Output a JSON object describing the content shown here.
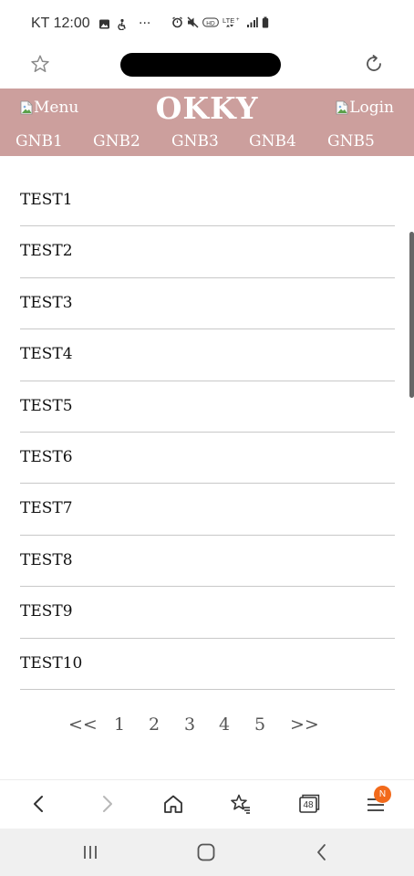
{
  "status_bar": {
    "carrier_time": "KT 12:00",
    "overflow_glyph": "···",
    "icons": [
      "gallery-icon",
      "accessibility-icon",
      "alarm-icon",
      "mute-icon",
      "hd-voice-icon",
      "lte-plus-icon",
      "signal-icon",
      "battery-icon"
    ]
  },
  "browser": {
    "url_redacted": true
  },
  "header": {
    "logo": "OKKY",
    "menu_alt": "Menu",
    "login_alt": "Login",
    "background_color": "#cc9f9d",
    "gnb": [
      "GNB1",
      "GNB2",
      "GNB3",
      "GNB4",
      "GNB5"
    ]
  },
  "list": {
    "items": [
      "TEST1",
      "TEST2",
      "TEST3",
      "TEST4",
      "TEST5",
      "TEST6",
      "TEST7",
      "TEST8",
      "TEST9",
      "TEST10"
    ]
  },
  "pagination": {
    "prev": "<<",
    "pages": [
      "1",
      "2",
      "3",
      "4",
      "5"
    ],
    "next": ">>"
  },
  "browser_toolbar": {
    "tabs_count": "48",
    "notification_badge": "N",
    "badge_color": "#f26a1b"
  }
}
